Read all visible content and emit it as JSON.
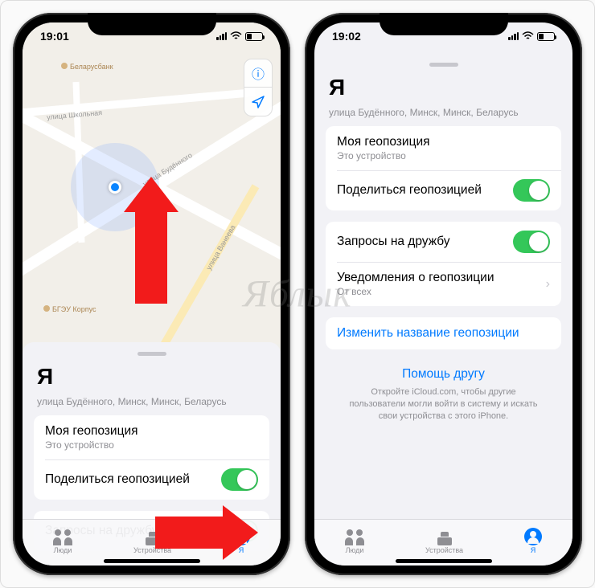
{
  "left": {
    "time": "19:01",
    "sheet_title": "Я",
    "address": "улица Будённого, Минск, Минск, Беларусь",
    "map": {
      "street_main": "улица Будённого",
      "street_2": "улица Школьная",
      "street_3": "улица Ванеева",
      "poi_1": "Беларусбанк",
      "poi_2": "БГЭУ Корпус"
    },
    "rows": {
      "my_loc_title": "Моя геопозиция",
      "my_loc_sub": "Это устройство",
      "share_title": "Поделиться геопозицией",
      "friend_req_title": "Запросы на дружбу"
    },
    "tabs": {
      "people": "Люди",
      "devices": "Устройства",
      "me": "Я"
    }
  },
  "right": {
    "time": "19:02",
    "sheet_title": "Я",
    "address": "улица Будённого, Минск, Минск, Беларусь",
    "rows": {
      "my_loc_title": "Моя геопозиция",
      "my_loc_sub": "Это устройство",
      "share_title": "Поделиться геопозицией",
      "friend_req_title": "Запросы на дружбу",
      "notif_title": "Уведомления о геопозиции",
      "notif_sub": "От всех",
      "rename": "Изменить название геопозиции"
    },
    "help": {
      "title": "Помощь другу",
      "sub": "Откройте iCloud.com, чтобы другие пользователи могли войти в систему и искать свои устройства с этого iPhone."
    },
    "tabs": {
      "people": "Люди",
      "devices": "Устройства",
      "me": "Я"
    }
  }
}
